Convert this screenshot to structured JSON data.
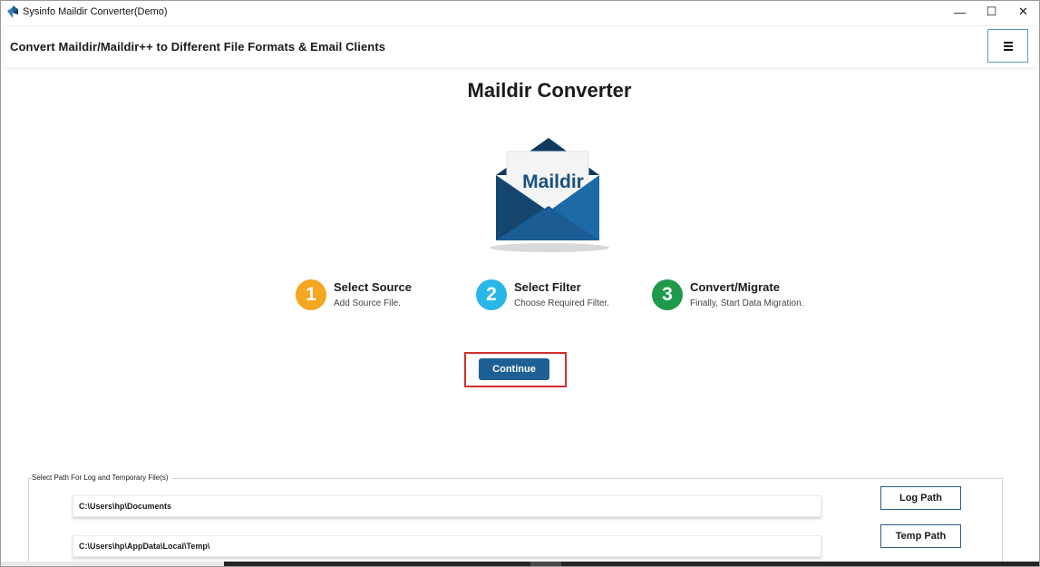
{
  "window": {
    "title": "Sysinfo Maildir Converter(Demo)",
    "controls": {
      "minimize": "—",
      "maximize": "☐",
      "close": "✕"
    }
  },
  "header": {
    "title": "Convert Maildir/Maildir++ to Different File Formats & Email Clients",
    "menu_icon": "hamburger-menu-icon"
  },
  "main": {
    "title": "Maildir Converter",
    "logo_text": "Maildir",
    "steps": [
      {
        "number": "1",
        "title": "Select Source",
        "subtitle": "Add Source File.",
        "color": "#f5a623"
      },
      {
        "number": "2",
        "title": "Select Filter",
        "subtitle": "Choose Required Filter.",
        "color": "#29b6e8"
      },
      {
        "number": "3",
        "title": "Convert/Migrate",
        "subtitle": "Finally, Start Data Migration.",
        "color": "#1f9a4d"
      }
    ],
    "continue_label": "Continue"
  },
  "paths": {
    "legend": "Select Path For Log and Temporary File(s)",
    "log_path_value": "C:\\Users\\hp\\Documents",
    "temp_path_value": "C:\\Users\\hp\\AppData\\Local\\Temp\\",
    "log_path_button": "Log Path",
    "temp_path_button": "Temp Path"
  },
  "colors": {
    "accent": "#1e5f94",
    "highlight_border": "#d32f2f",
    "logo_dark": "#0f3a5f",
    "logo_light": "#1e6aa6"
  }
}
